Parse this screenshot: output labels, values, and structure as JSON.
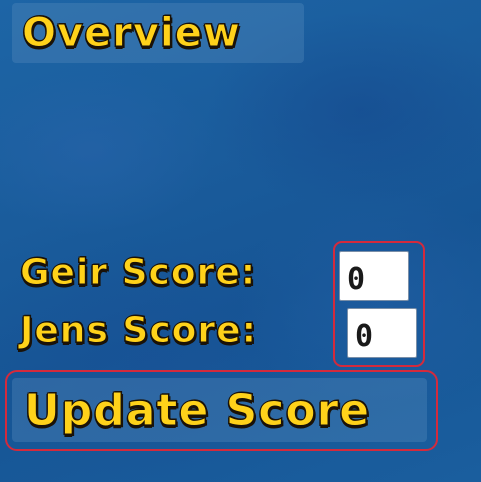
{
  "header": {
    "title": "Overview"
  },
  "scores": {
    "geir_label": "Geir Score:",
    "geir_value": "0",
    "jens_label": "Jens Score:",
    "jens_value": "0"
  },
  "actions": {
    "update_label": "Update Score"
  },
  "colors": {
    "background": "#1a5c9c",
    "label_text": "#ffd21a",
    "text_outline": "#1a1208",
    "highlight_border": "#d42a3c",
    "panel": "#5a8cbe"
  }
}
